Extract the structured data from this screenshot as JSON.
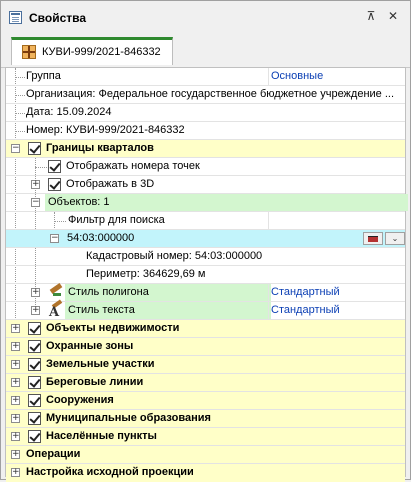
{
  "window": {
    "title": "Свойства",
    "pin_glyph": "⊼",
    "close_glyph": "✕"
  },
  "tab": {
    "label": "КУВИ-999/2021-846332"
  },
  "props": {
    "group_label": "Группа",
    "group_value": "Основные",
    "org": "Организация: Федеральное государственное бюджетное учреждение ...",
    "date": "Дата: 15.09.2024",
    "number": "Номер: КУВИ-999/2021-846332",
    "boundaries": "Границы кварталов",
    "show_points": "Отображать номера точек",
    "show_3d": "Отображать в 3D",
    "objects": "Объектов: 1",
    "filter": "Фильтр для поиска",
    "object_id": "54:03:000000",
    "cadastral": "Кадастровый номер: 54:03:000000",
    "perimeter": "Периметр: 364629,69 м",
    "polygon_style_label": "Стиль полигона",
    "polygon_style_value": "Стандартный",
    "text_style_label": "Стиль текста",
    "text_style_value": "Стандартный",
    "layers": [
      "Объекты недвижимости",
      "Охранные зоны",
      "Земельные участки",
      "Береговые линии",
      "Сооружения",
      "Муниципальные образования",
      "Населённые пункты"
    ],
    "operations": "Операции",
    "projection": "Настройка исходной проекции"
  },
  "glyphs": {
    "collapse": "−",
    "expand": "+",
    "dropdown": "⌄"
  },
  "colors": {
    "layer_row": "#ffffc8",
    "selected_row": "#d3f6cf",
    "edit_row": "#c2f4fb",
    "value_text": "#0b3fb4",
    "tab_accent": "#2f8a2f"
  }
}
